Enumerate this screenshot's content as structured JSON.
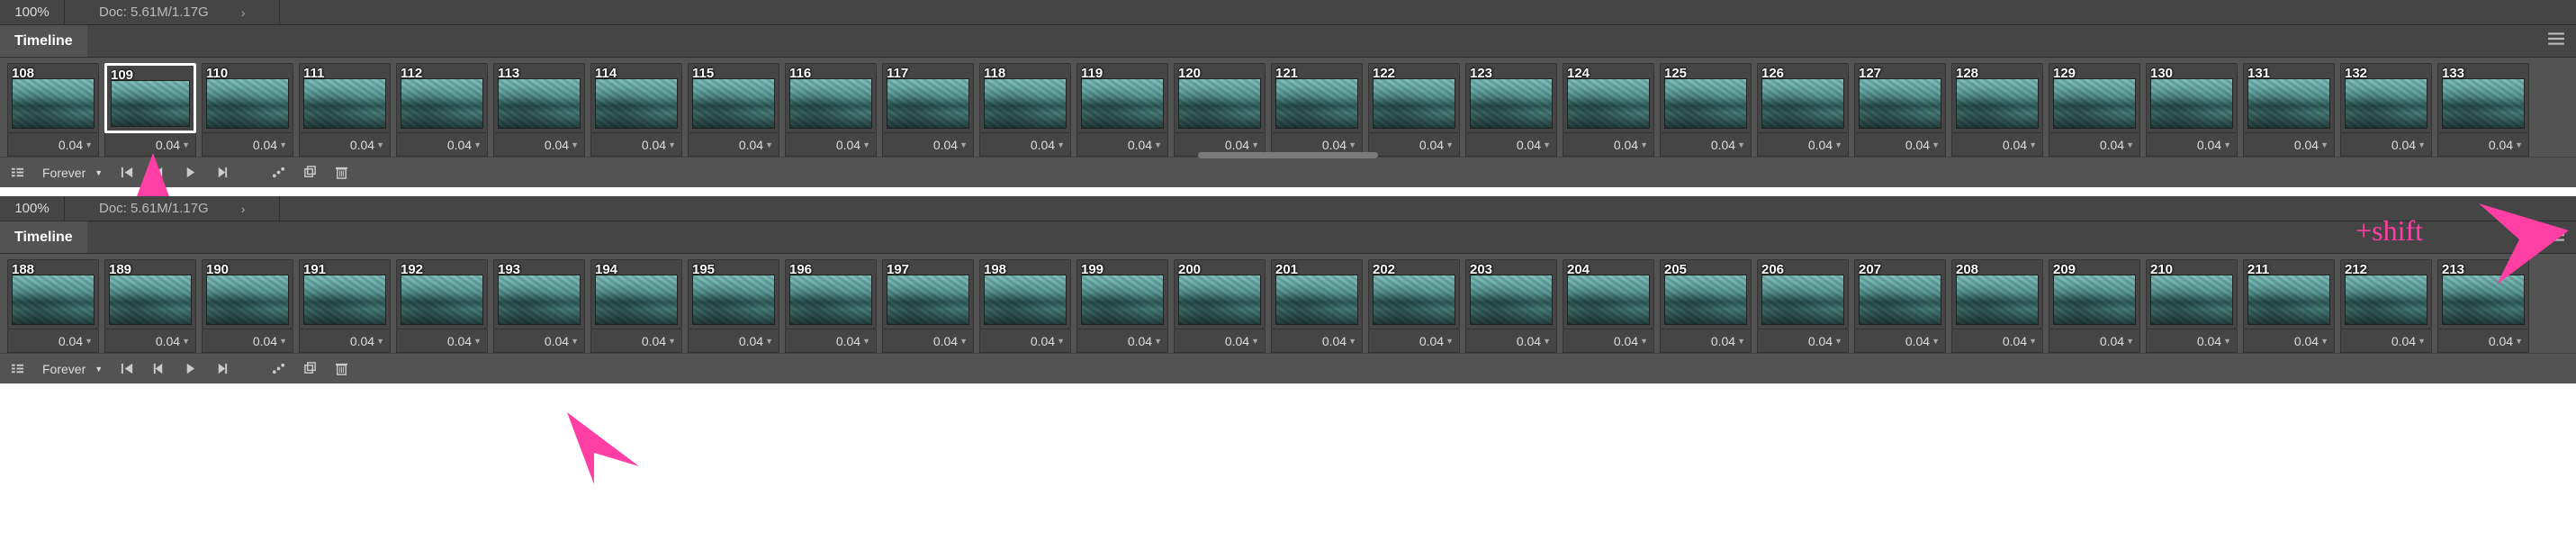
{
  "top": {
    "zoom": "100%",
    "doc": "Doc: 5.61M/1.17G",
    "panel_title": "Timeline",
    "loop_label": "Forever",
    "frame_delay": "0.04",
    "first_frame_delay": "0.04",
    "selected_frame": 109,
    "frames": [
      108,
      109,
      110,
      111,
      112,
      113,
      114,
      115,
      116,
      117,
      118,
      119,
      120,
      121,
      122,
      123,
      124,
      125,
      126,
      127,
      128,
      129,
      130,
      131,
      132,
      133
    ]
  },
  "bottom": {
    "zoom": "100%",
    "doc": "Doc: 5.61M/1.17G",
    "panel_title": "Timeline",
    "loop_label": "Forever",
    "frame_delay": "0.04",
    "selected_frame": null,
    "frames": [
      188,
      189,
      190,
      191,
      192,
      193,
      194,
      195,
      196,
      197,
      198,
      199,
      200,
      201,
      202,
      203,
      204,
      205,
      206,
      207,
      208,
      209,
      210,
      211,
      212,
      213
    ]
  },
  "annotations": {
    "shift_label": "+shift"
  },
  "colors": {
    "accent": "#ff3fa4",
    "panel_bg": "#535353",
    "dark_bg": "#454545",
    "border": "#333333",
    "text": "#e6e6e6"
  }
}
